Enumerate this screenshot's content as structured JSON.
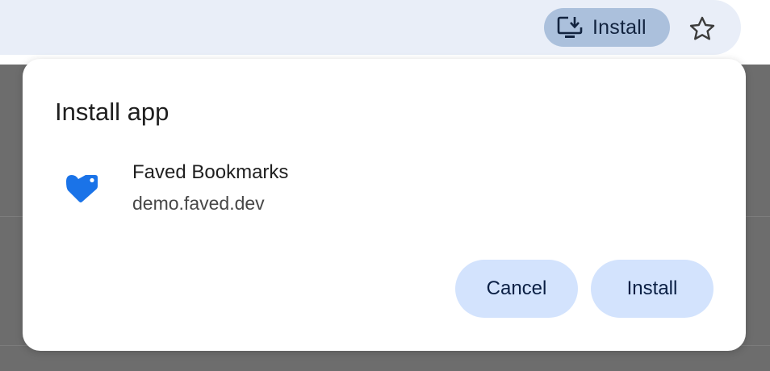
{
  "toolbar": {
    "install_chip": {
      "label": "Install",
      "icon": "install-desktop-icon"
    },
    "bookmark_star_icon": "star-outline-icon"
  },
  "dialog": {
    "title": "Install app",
    "app": {
      "name": "Faved Bookmarks",
      "domain": "demo.faved.dev",
      "icon": "faved-heart-tag-icon"
    },
    "buttons": {
      "cancel_label": "Cancel",
      "install_label": "Install"
    }
  },
  "colors": {
    "omnibox_bg": "#e9eef8",
    "chip_bg": "#abc0dc",
    "button_bg": "#d3e3fd",
    "button_text": "#0a1f44",
    "app_icon_blue": "#1a73e8",
    "page_overlay": "#6d6d6d"
  }
}
